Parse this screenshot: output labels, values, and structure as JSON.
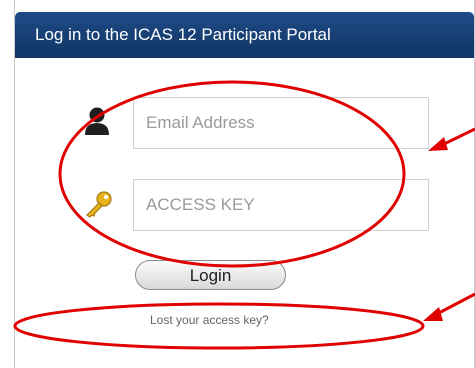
{
  "header": {
    "title": "Log in to the ICAS 12 Participant Portal",
    "background_color": "#1a437a"
  },
  "form": {
    "email_placeholder": "Email Address",
    "access_key_placeholder": "ACCESS KEY",
    "login_label": "Login",
    "lost_key_link": "Lost your access key?"
  },
  "icons": {
    "email_field_icon": "user-icon",
    "access_key_field_icon": "key-icon"
  },
  "annotations": {
    "color": "#e00000",
    "marks": [
      "ellipse around input fields",
      "arrow to input fields",
      "ellipse around lost key link",
      "arrow to lost key link"
    ]
  }
}
